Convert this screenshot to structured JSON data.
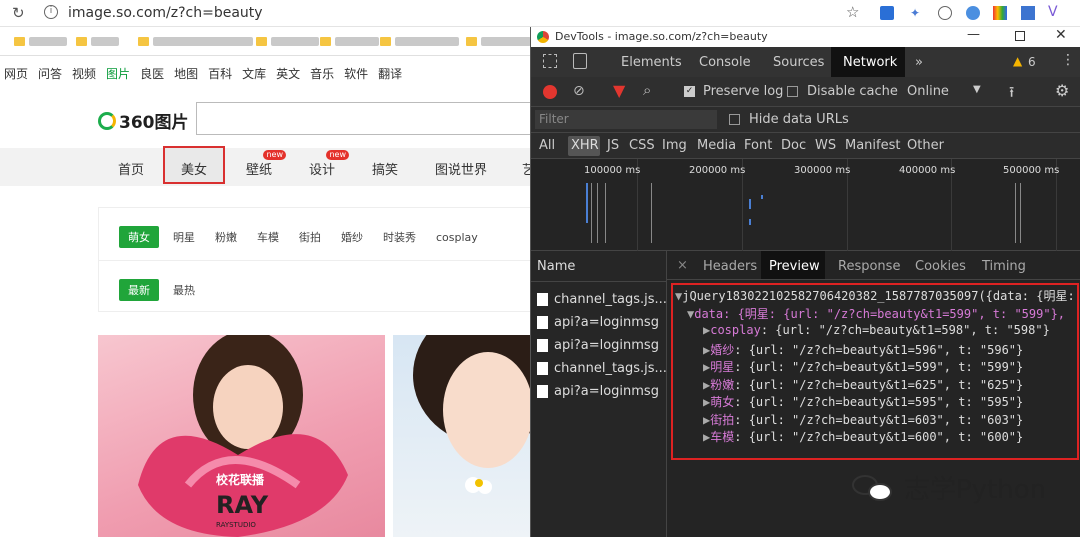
{
  "address_bar": {
    "url": "image.so.com/z?ch=beauty"
  },
  "site": {
    "nav_links": [
      "网页",
      "问答",
      "视频",
      "图片",
      "良医",
      "地图",
      "百科",
      "文库",
      "英文",
      "音乐",
      "软件",
      "翻译"
    ],
    "active_nav": "图片",
    "logo_text": "360图片",
    "categories": [
      "首页",
      "美女",
      "壁纸",
      "设计",
      "搞笑",
      "图说世界",
      "艺"
    ],
    "new_badge": "new",
    "tag_row1_active": "萌女",
    "tag_row1": [
      "明星",
      "粉嫩",
      "车模",
      "街拍",
      "婚纱",
      "时装秀",
      "cosplay"
    ],
    "tag_row2_active": "最新",
    "tag_row2": [
      "最热"
    ]
  },
  "devtools": {
    "title": "DevTools - image.so.com/z?ch=beauty",
    "tabs": [
      "Elements",
      "Console",
      "Sources",
      "Network",
      "»"
    ],
    "active_tab": "Network",
    "warning_count": "6",
    "preserve_log": "Preserve log",
    "disable_cache": "Disable cache",
    "throttle": "Online",
    "filter_placeholder": "Filter",
    "hide_data_urls": "Hide data URLs",
    "types": [
      "All",
      "XHR",
      "JS",
      "CSS",
      "Img",
      "Media",
      "Font",
      "Doc",
      "WS",
      "Manifest",
      "Other"
    ],
    "active_type": "XHR",
    "timeline_ticks": [
      "100000 ms",
      "200000 ms",
      "300000 ms",
      "400000 ms",
      "500000 ms"
    ],
    "list_header": "Name",
    "requests": [
      "channel_tags.js...",
      "api?a=loginmsg",
      "api?a=loginmsg",
      "channel_tags.js...",
      "api?a=loginmsg"
    ],
    "detail_tabs": [
      "Headers",
      "Preview",
      "Response",
      "Cookies",
      "Timing"
    ],
    "active_detail_tab": "Preview",
    "close_symbol": "×",
    "preview_root": "jQuery18302210258270642038​2_1587787035097({data: {明星:",
    "preview_data_line": "data: {明星: {url: \"/z?ch=beauty&t1=599\", t: \"599\"},",
    "preview_items": [
      {
        "key": "cosplay",
        "value": "{url: \"/z?ch=beauty&t1=598\", t: \"598\"}"
      },
      {
        "key": "婚纱",
        "value": "{url: \"/z?ch=beauty&t1=596\", t: \"596\"}"
      },
      {
        "key": "明星",
        "value": "{url: \"/z?ch=beauty&t1=599\", t: \"599\"}"
      },
      {
        "key": "粉嫩",
        "value": "{url: \"/z?ch=beauty&t1=625\", t: \"625\"}"
      },
      {
        "key": "萌女",
        "value": "{url: \"/z?ch=beauty&t1=595\", t: \"595\"}"
      },
      {
        "key": "街拍",
        "value": "{url: \"/z?ch=beauty&t1=603\", t: \"603\"}"
      },
      {
        "key": "车模",
        "value": "{url: \"/z?ch=beauty&t1=600\", t: \"600\"}"
      }
    ]
  },
  "watermark": "志学Python",
  "photo_text": {
    "brand": "校花联播",
    "ray": "RAY",
    "studio": "RAYSTUDIO"
  }
}
